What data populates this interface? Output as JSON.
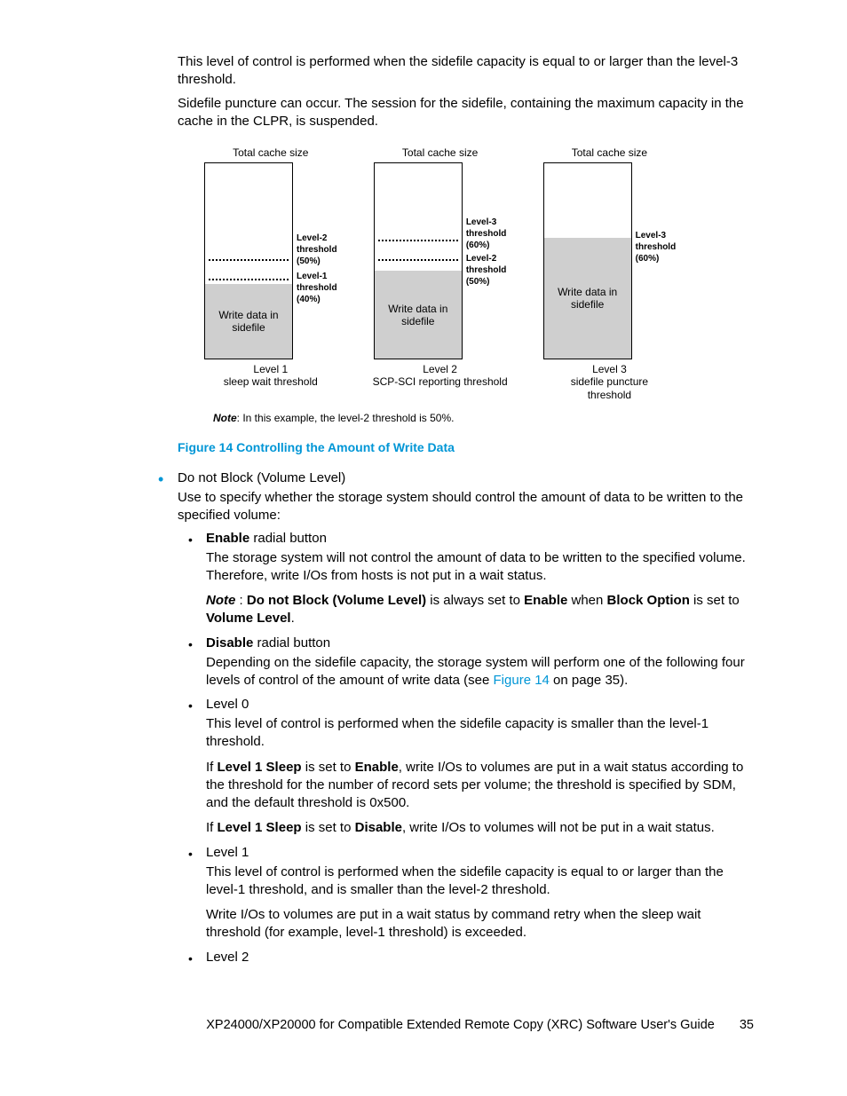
{
  "intro": {
    "p1": "This level of control is performed when the sidefile capacity is equal to or larger than the level-3 threshold.",
    "p2": "Sidefile puncture can occur. The session for the sidefile, containing the maximum capacity in the cache in the CLPR, is suspended."
  },
  "figure": {
    "total_cache": "Total cache size",
    "write_data": "Write data in",
    "sidefile": "sidefile",
    "lvl1_thr": "Level-1",
    "lvl2_thr": "Level-2",
    "lvl3_thr": "Level-3",
    "threshold": "threshold",
    "p40": "(40%)",
    "p50": "(50%)",
    "p60": "(60%)",
    "cap1a": "Level 1",
    "cap1b": "sleep wait threshold",
    "cap2a": "Level 2",
    "cap2b": "SCP-SCI reporting threshold",
    "cap3a": "Level 3",
    "cap3b": "sidefile puncture",
    "cap3c": "threshold",
    "note_label": "Note",
    "note_text": ":   In this example, the level-2 threshold is 50%.",
    "title": "Figure 14 Controlling the Amount of Write Data"
  },
  "bullets": {
    "main_label": "Do not Block (Volume Level)",
    "main_desc": "Use to specify whether the storage system should control the amount of data to be written to the specified volume:",
    "enable": {
      "head_bold": "Enable",
      "head_rest": " radial button",
      "p1": "The storage system will not control the amount of data to be written to the specified volume. Therefore, write I/Os from hosts is not put in a wait status.",
      "note_bold1": "Note",
      "note_mid1": " : ",
      "note_bold2": "Do not Block (Volume Level)",
      "note_mid2": " is always set to ",
      "note_bold3": "Enable",
      "note_mid3": " when ",
      "note_bold4": "Block Option",
      "note_mid4": " is set to ",
      "note_bold5": "Volume Level",
      "note_end": "."
    },
    "disable": {
      "head_bold": "Disable",
      "head_rest": " radial button",
      "p1a": "Depending on the sidefile capacity, the storage system will perform one of the following four levels of control of the amount of write data (see ",
      "link": "Figure 14",
      "p1b": " on page 35)."
    },
    "lvl0": {
      "head": "Level 0",
      "p1": "This level of control is performed when the sidefile capacity is smaller than the level-1 threshold.",
      "p2a": "If ",
      "p2b": "Level 1 Sleep",
      "p2c": " is set to ",
      "p2d": "Enable",
      "p2e": ", write I/Os to volumes are put in a wait status according to the threshold for the number of record sets per volume; the threshold is specified by SDM, and the default threshold is 0x500.",
      "p3a": "If ",
      "p3b": "Level 1 Sleep",
      "p3c": " is set to ",
      "p3d": "Disable",
      "p3e": ", write I/Os to volumes will not be put in a wait status."
    },
    "lvl1": {
      "head": "Level 1",
      "p1": "This level of control is performed when the sidefile capacity is equal to or larger than the level-1 threshold, and is smaller than the level-2 threshold.",
      "p2": "Write I/Os to volumes are put in a wait status by command retry when the sleep wait threshold (for example, level-1 threshold) is exceeded."
    },
    "lvl2": {
      "head": "Level 2"
    }
  },
  "footer": {
    "title": "XP24000/XP20000 for Compatible Extended Remote Copy (XRC) Software User's Guide",
    "page": "35"
  }
}
